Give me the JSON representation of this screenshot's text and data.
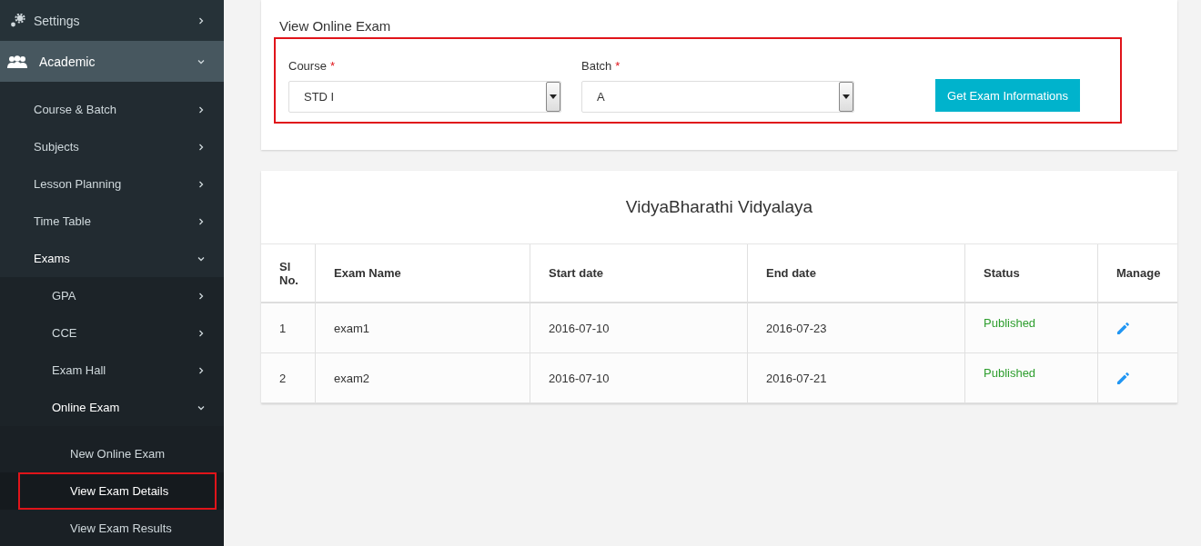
{
  "sidebar": {
    "items": [
      {
        "label": "Settings",
        "expanded": false
      },
      {
        "label": "Academic",
        "expanded": true,
        "children": [
          {
            "label": "Course & Batch",
            "expanded": false
          },
          {
            "label": "Subjects",
            "expanded": false
          },
          {
            "label": "Lesson Planning",
            "expanded": false
          },
          {
            "label": "Time Table",
            "expanded": false
          },
          {
            "label": "Exams",
            "expanded": true,
            "children": [
              {
                "label": "GPA",
                "expanded": false
              },
              {
                "label": "CCE",
                "expanded": false
              },
              {
                "label": "Exam Hall",
                "expanded": false
              },
              {
                "label": "Online Exam",
                "expanded": true,
                "children": [
                  {
                    "label": "New Online Exam",
                    "selected": false
                  },
                  {
                    "label": "View Exam Details",
                    "selected": true
                  },
                  {
                    "label": "View Exam Results",
                    "selected": false
                  }
                ]
              }
            ]
          }
        ]
      }
    ]
  },
  "filter": {
    "title": "View Online Exam",
    "highlighted": true,
    "fields": [
      {
        "label": "Course",
        "required_mark": "*",
        "value": "STD I"
      },
      {
        "label": "Batch",
        "required_mark": "*",
        "value": "A"
      }
    ],
    "button": "Get Exam Informations"
  },
  "table": {
    "title": "VidyaBharathi Vidyalaya",
    "columns": [
      "Sl No.",
      "Exam Name",
      "Start date",
      "End date",
      "Status",
      "Manage"
    ],
    "rows": [
      {
        "sl": "1",
        "name": "exam1",
        "start": "2016-07-10",
        "end": "2016-07-23",
        "status": "Published"
      },
      {
        "sl": "2",
        "name": "exam2",
        "start": "2016-07-10",
        "end": "2016-07-21",
        "status": "Published"
      }
    ]
  }
}
